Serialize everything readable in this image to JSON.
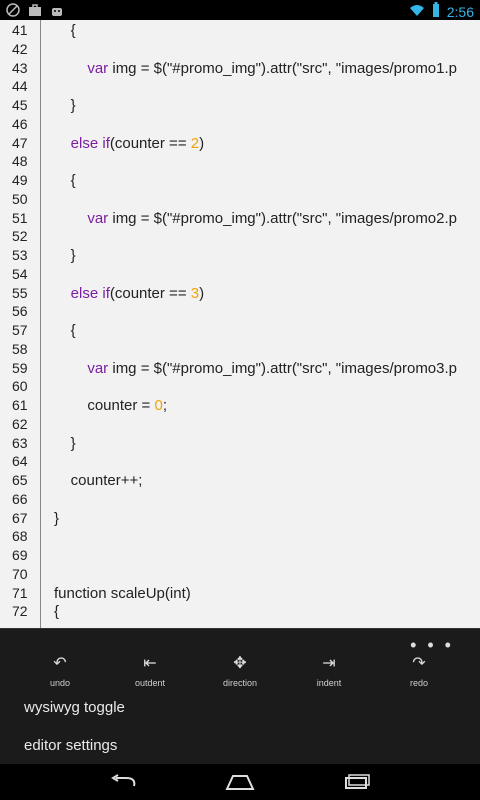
{
  "status_bar": {
    "time": "2:56",
    "icons": [
      "circle-slash-icon",
      "briefcase-icon",
      "android-icon",
      "wifi-icon",
      "battery-icon"
    ]
  },
  "code_lines": [
    {
      "n": "41",
      "html": "    {"
    },
    {
      "n": "42",
      "html": ""
    },
    {
      "n": "43",
      "html": "        <span class=\"kw\">var</span> img = $(\"#promo_img\").attr(\"src\", \"images/promo1.p"
    },
    {
      "n": "44",
      "html": ""
    },
    {
      "n": "45",
      "html": "    }"
    },
    {
      "n": "46",
      "html": ""
    },
    {
      "n": "47",
      "html": "    <span class=\"kw\">else if</span>(counter == <span class=\"num\">2</span>)"
    },
    {
      "n": "48",
      "html": ""
    },
    {
      "n": "49",
      "html": "    {"
    },
    {
      "n": "50",
      "html": ""
    },
    {
      "n": "51",
      "html": "        <span class=\"kw\">var</span> img = $(\"#promo_img\").attr(\"src\", \"images/promo2.p"
    },
    {
      "n": "52",
      "html": ""
    },
    {
      "n": "53",
      "html": "    }"
    },
    {
      "n": "54",
      "html": ""
    },
    {
      "n": "55",
      "html": "    <span class=\"kw\">else if</span>(counter == <span class=\"num\">3</span>)"
    },
    {
      "n": "56",
      "html": ""
    },
    {
      "n": "57",
      "html": "    {"
    },
    {
      "n": "58",
      "html": ""
    },
    {
      "n": "59",
      "html": "        <span class=\"kw\">var</span> img = $(\"#promo_img\").attr(\"src\", \"images/promo3.p"
    },
    {
      "n": "60",
      "html": ""
    },
    {
      "n": "61",
      "html": "        counter = <span class=\"num\">0</span>;"
    },
    {
      "n": "62",
      "html": ""
    },
    {
      "n": "63",
      "html": "    }"
    },
    {
      "n": "64",
      "html": ""
    },
    {
      "n": "65",
      "html": "    counter++;"
    },
    {
      "n": "66",
      "html": ""
    },
    {
      "n": "67",
      "html": "}"
    },
    {
      "n": "68",
      "html": ""
    },
    {
      "n": "69",
      "html": ""
    },
    {
      "n": "70",
      "html": ""
    },
    {
      "n": "71",
      "html": "function scaleUp(int)"
    },
    {
      "n": "72",
      "html": "{"
    }
  ],
  "menu": {
    "overflow": "⋮",
    "actions": [
      {
        "label": "undo",
        "icon": "undo-icon",
        "glyph": "↶"
      },
      {
        "label": "outdent",
        "icon": "outdent-icon",
        "glyph": "⇤"
      },
      {
        "label": "direction",
        "icon": "direction-icon",
        "glyph": "✥"
      },
      {
        "label": "indent",
        "icon": "indent-icon",
        "glyph": "⇥"
      },
      {
        "label": "redo",
        "icon": "redo-icon",
        "glyph": "↷"
      }
    ],
    "wysiwyg_toggle": "wysiwyg toggle",
    "editor_settings": "editor settings"
  },
  "nav": {
    "back_icon": "back-icon",
    "home_icon": "home-icon",
    "recents_icon": "recents-icon"
  }
}
